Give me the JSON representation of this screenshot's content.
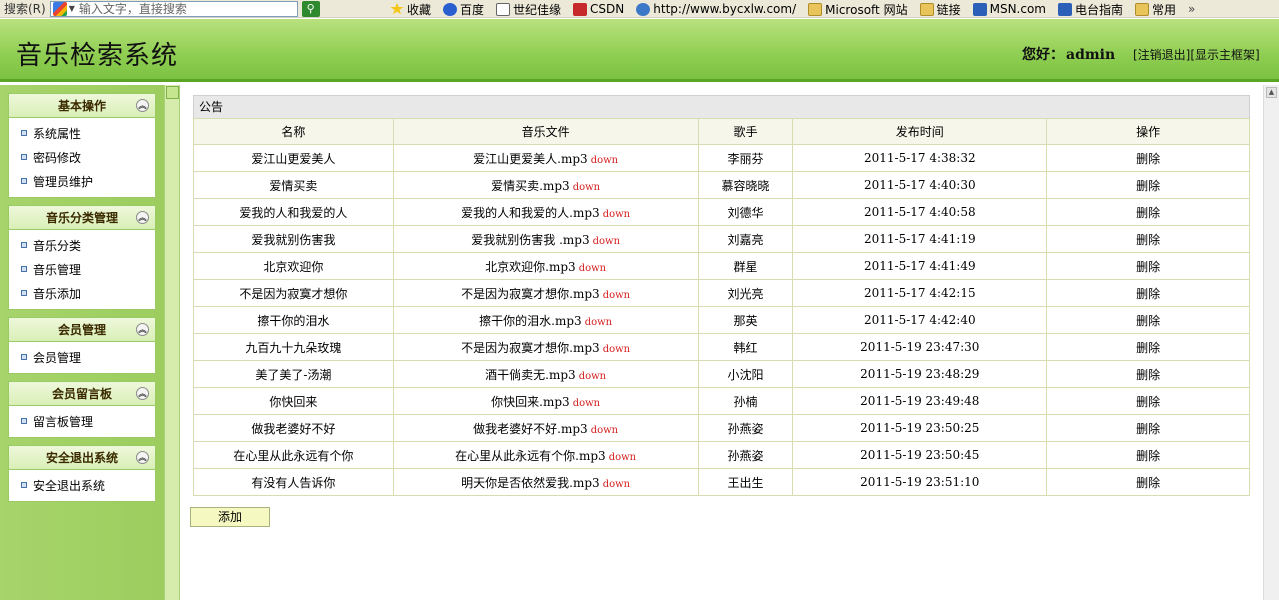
{
  "toolbar": {
    "search_label": "搜索(R)",
    "search_placeholder": "输入文字，直接搜索",
    "links": [
      {
        "icon": "star-icon",
        "label": "收藏"
      },
      {
        "icon": "paw-icon",
        "label": "百度"
      },
      {
        "icon": "doc-icon",
        "label": "世纪佳缘"
      },
      {
        "icon": "c-icon",
        "label": "CSDN"
      },
      {
        "icon": "ie-icon",
        "label": "http://www.bycxlw.com/"
      },
      {
        "icon": "folder-icon",
        "label": "Microsoft 网站"
      },
      {
        "icon": "folder-icon",
        "label": "链接"
      },
      {
        "icon": "msn-icon",
        "label": "MSN.com"
      },
      {
        "icon": "msn-icon",
        "label": "电台指南"
      },
      {
        "icon": "folder-icon",
        "label": "常用"
      }
    ],
    "more": "»"
  },
  "header": {
    "title": "音乐检索系统",
    "greeting": "您好：",
    "username": "admin",
    "logout": "[注销退出]",
    "show_frame": "[显示主框架]"
  },
  "sidebar": {
    "toggle_glyph": "︽",
    "groups": [
      {
        "title": "基本操作",
        "items": [
          "系统属性",
          "密码修改",
          "管理员维护"
        ]
      },
      {
        "title": "音乐分类管理",
        "items": [
          "音乐分类",
          "音乐管理",
          "音乐添加"
        ]
      },
      {
        "title": "会员管理",
        "items": [
          "会员管理"
        ]
      },
      {
        "title": "会员留言板",
        "items": [
          "留言板管理"
        ]
      },
      {
        "title": "安全退出系统",
        "items": [
          "安全退出系统"
        ]
      }
    ]
  },
  "main": {
    "notice": "公告",
    "columns": [
      "名称",
      "音乐文件",
      "歌手",
      "发布时间",
      "操作"
    ],
    "down_label": "down",
    "delete_label": "删除",
    "rows": [
      {
        "name": "爱江山更爱美人",
        "file": "爱江山更爱美人.mp3",
        "singer": "李丽芬",
        "time": "2011-5-17 4:38:32"
      },
      {
        "name": "爱情买卖",
        "file": "爱情买卖.mp3",
        "singer": "慕容晓晓",
        "time": "2011-5-17 4:40:30"
      },
      {
        "name": "爱我的人和我爱的人",
        "file": "爱我的人和我爱的人.mp3",
        "singer": "刘德华",
        "time": "2011-5-17 4:40:58"
      },
      {
        "name": "爱我就别伤害我",
        "file": "爱我就别伤害我 .mp3",
        "singer": "刘嘉亮",
        "time": "2011-5-17 4:41:19"
      },
      {
        "name": "北京欢迎你",
        "file": "北京欢迎你.mp3",
        "singer": "群星",
        "time": "2011-5-17 4:41:49"
      },
      {
        "name": "不是因为寂寞才想你",
        "file": "不是因为寂寞才想你.mp3",
        "singer": "刘光亮",
        "time": "2011-5-17 4:42:15"
      },
      {
        "name": "擦干你的泪水",
        "file": "擦干你的泪水.mp3",
        "singer": "那英",
        "time": "2011-5-17 4:42:40"
      },
      {
        "name": "九百九十九朵玫瑰",
        "file": "不是因为寂寞才想你.mp3",
        "singer": "韩红",
        "time": "2011-5-19 23:47:30"
      },
      {
        "name": "美了美了-汤潮",
        "file": "酒干倘卖无.mp3",
        "singer": "小沈阳",
        "time": "2011-5-19 23:48:29"
      },
      {
        "name": "你快回来",
        "file": "你快回来.mp3",
        "singer": "孙楠",
        "time": "2011-5-19 23:49:48"
      },
      {
        "name": "做我老婆好不好",
        "file": "做我老婆好不好.mp3",
        "singer": "孙燕姿",
        "time": "2011-5-19 23:50:25"
      },
      {
        "name": "在心里从此永远有个你",
        "file": "在心里从此永远有个你.mp3",
        "singer": "孙燕姿",
        "time": "2011-5-19 23:50:45"
      },
      {
        "name": "有没有人告诉你",
        "file": "明天你是否依然爱我.mp3",
        "singer": "王出生",
        "time": "2011-5-19 23:51:10"
      }
    ],
    "add_label": "添加"
  }
}
